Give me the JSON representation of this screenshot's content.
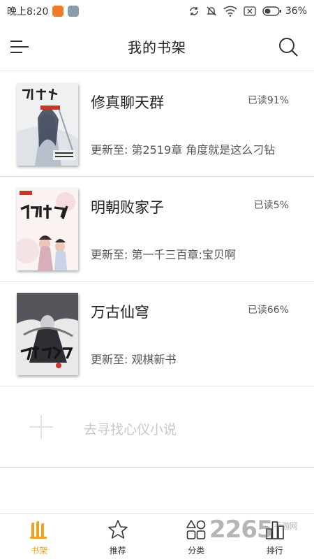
{
  "status_bar": {
    "time": "晚上8:20",
    "battery": "36%"
  },
  "header": {
    "title": "我的书架",
    "menu_icon": "menu-icon",
    "search_icon": "search-icon"
  },
  "books": [
    {
      "title": "修真聊天群",
      "progress": "已读91%",
      "update": "更新至: 第2519章 角度就是这么刁钻"
    },
    {
      "title": "明朝败家子",
      "progress": "已读5%",
      "update": "更新至: 第一千三百章:宝贝啊"
    },
    {
      "title": "万古仙穹",
      "progress": "已读66%",
      "update": "更新至: 观棋新书"
    }
  ],
  "find_more": {
    "label": "去寻找心仪小说"
  },
  "bottom_nav": {
    "tabs": [
      {
        "label": "书架",
        "icon": "bookshelf-icon",
        "active": true
      },
      {
        "label": "推荐",
        "icon": "star-icon",
        "active": false
      },
      {
        "label": "分类",
        "icon": "category-icon",
        "active": false
      },
      {
        "label": "排行",
        "icon": "ranking-icon",
        "active": false
      }
    ]
  },
  "watermark": {
    "text": "2265",
    "sub": "手游网"
  },
  "colors": {
    "accent": "#f0a01e",
    "divider": "#e4e4e4"
  }
}
